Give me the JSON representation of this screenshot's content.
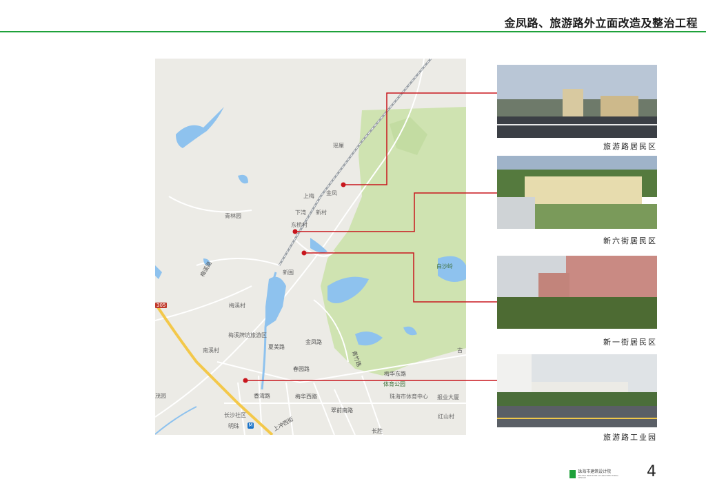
{
  "header": {
    "title": "金凤路、旅游路外立面改造及整治工程"
  },
  "colors": {
    "accent_green": "#1ea13a",
    "callout_red": "#c8161d",
    "park_green": "#cfe3b1",
    "water_blue": "#8ec2ee"
  },
  "map": {
    "labels": {
      "yaoya": "瑶厘",
      "shangmu": "上梅",
      "dongjian": "东坝",
      "xiawan": "下湾",
      "xincun": "新村",
      "qinglin": "青林园",
      "dongqiao": "东桥村",
      "xinwei": "新围",
      "jinzhou": "梅溪村",
      "baishafeng": "白沙岭",
      "meixi_zone": "梅溪牌坊旅游区",
      "meixi_road": "梅溪路",
      "wanqi": "南溪村",
      "jinfeng_road": "金凤路",
      "tiyu_park": "体育公园",
      "tiyu_center": "珠海市体育中心",
      "qingzhu": "青竹路",
      "meihua_road": "梅华东路",
      "meihua_w": "梅华西路",
      "baoye": "报业大厦",
      "xihe": "夏美路",
      "xiangzhou": "香湾路",
      "changsha": "长沙社区",
      "mingzhu": "明珠",
      "shangchong": "上冲西街",
      "cuiqian": "翠前南路",
      "qiyunjie": "乐园路",
      "yingbin": "迎宾路",
      "renmin": "人民路",
      "tanghu": "唐湖路",
      "wenhua": "春园路",
      "hongshan": "红山村",
      "yingbinroad": "英路",
      "changsheng": "长胜",
      "jinfeng2": "金凤",
      "nanwan": "茂园",
      "qianhe": "前山",
      "shield_305": "305",
      "metro_m": "M",
      "gu": "古"
    }
  },
  "photos": [
    {
      "caption": "旅游路居民区"
    },
    {
      "caption": "新六街居民区"
    },
    {
      "caption": "新一街居民区"
    },
    {
      "caption": "旅游路工业园"
    }
  ],
  "footer": {
    "logo_cn": "珠海市建筑设计院",
    "logo_en": "ZHUHAI INSTITUTE OF ARCHITECTURAL DESIGN",
    "page_number": "4"
  }
}
